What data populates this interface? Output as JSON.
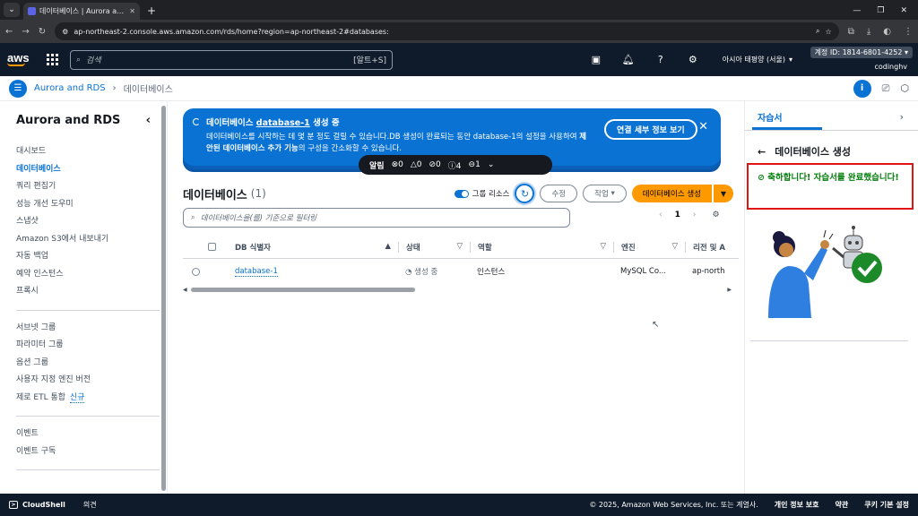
{
  "browser": {
    "tab_title": "데이터베이스 | Aurora and RDS",
    "url": "ap-northeast-2.console.aws.amazon.com/rds/home?region=ap-northeast-2#databases:"
  },
  "awsnav": {
    "logo": "aws",
    "search_placeholder": "검색",
    "search_shortcut": "[알트+S]",
    "region": "아시아 태평양 (서울)",
    "account": "계정 ID: 1814-6801-4252",
    "username": "codinghv"
  },
  "breadcrumb": {
    "service": "Aurora and RDS",
    "current": "데이터베이스"
  },
  "sidebar": {
    "title": "Aurora and RDS",
    "group1": [
      "대시보드",
      "데이터베이스",
      "쿼리 편집기",
      "성능 개선 도우미",
      "스냅샷",
      "Amazon S3에서 내보내기",
      "자동 백업",
      "예약 인스턴스",
      "프록시"
    ],
    "group2": [
      "서브넷 그룹",
      "파라미터 그룹",
      "옵션 그룹",
      "사용자 지정 엔진 버전"
    ],
    "zero_etl": "제로 ETL 통합",
    "new_badge": "신규",
    "group3": [
      "이벤트",
      "이벤트 구독"
    ]
  },
  "flash": {
    "title_prefix": "데이터베이스",
    "title_db": "database-1",
    "title_suffix": "생성 중",
    "body_1": "데이터베이스를 시작하는 데 몇 분 정도 걸릴 수 있습니다.DB 생성이 완료되는 동안 database-1의 설정을 사용하여 ",
    "body_bold": "제안된 데이터베이스 추가 기능",
    "body_2": "의 구성을 간소화할 수 있습니다.",
    "button": "연결 세부 정보 보기"
  },
  "alerts": {
    "label": "알림",
    "error": "0",
    "warning": "0",
    "success": "0",
    "info": "4",
    "progress": "1"
  },
  "databases": {
    "title": "데이터베이스",
    "count": "(1)",
    "group_toggle": "그룹 리소스",
    "modify": "수정",
    "actions": "작업",
    "create": "데이터베이스 생성",
    "filter_placeholder": "데이터베이스을(를) 기준으로 필터링",
    "page": "1",
    "columns": [
      "DB 식별자",
      "상태",
      "역할",
      "엔진",
      "리전 및 A"
    ],
    "rows": [
      {
        "id": "database-1",
        "status": "생성 중",
        "role": "인스턴스",
        "engine": "MySQL Co...",
        "region": "ap-north"
      }
    ]
  },
  "tutorial": {
    "tab": "자습서",
    "header": "데이터베이스 생성",
    "congrats": "축하합니다! 자습서를 완료했습니다!"
  },
  "footer": {
    "cloudshell": "CloudShell",
    "feedback": "의견",
    "copyright": "© 2025, Amazon Web Services, Inc. 또는 계열사.",
    "privacy": "개인 정보 보호",
    "terms": "약관",
    "cookies": "쿠키 기본 설정"
  },
  "colors": {
    "primary": "#0972d3",
    "aws_nav": "#0f1b2a",
    "orange": "#ff9900",
    "success": "#037f0c",
    "highlight_border": "#e01414"
  }
}
